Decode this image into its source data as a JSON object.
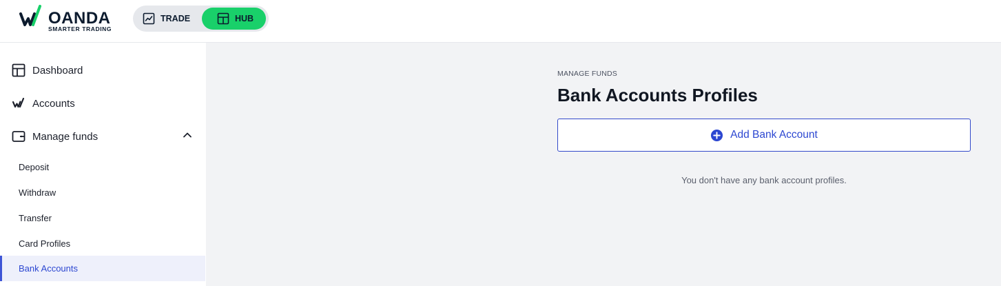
{
  "brand": {
    "name": "OANDA",
    "tagline": "SMARTER TRADING",
    "accent": "#19d06a",
    "dark": "#0c1b2e"
  },
  "switcher": {
    "trade_label": "TRADE",
    "hub_label": "HUB",
    "active": "hub",
    "trade_icon": "chart-line-icon",
    "hub_icon": "layout-grid-icon"
  },
  "sidebar": {
    "items": [
      {
        "label": "Dashboard",
        "icon": "layout-grid-icon"
      },
      {
        "label": "Accounts",
        "icon": "oanda-mark-icon"
      },
      {
        "label": "Manage funds",
        "icon": "wallet-icon",
        "expanded": true
      }
    ],
    "sub_items": [
      {
        "label": "Deposit"
      },
      {
        "label": "Withdraw"
      },
      {
        "label": "Transfer"
      },
      {
        "label": "Card Profiles"
      },
      {
        "label": "Bank Accounts",
        "active": true
      }
    ],
    "active_color": "#3e55d6"
  },
  "main": {
    "eyebrow": "MANAGE FUNDS",
    "title": "Bank Accounts Profiles",
    "add_button_label": "Add Bank Account",
    "add_button_icon": "plus-circle-icon",
    "empty_message": "You don't have any bank account profiles."
  }
}
